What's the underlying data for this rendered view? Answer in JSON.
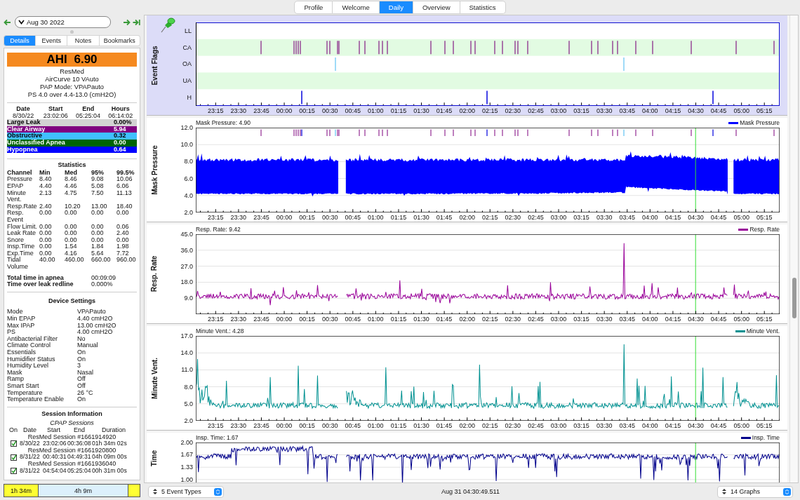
{
  "top_tabs": [
    {
      "label": "Profile",
      "selected": false
    },
    {
      "label": "Welcome",
      "selected": false
    },
    {
      "label": "Daily",
      "selected": true
    },
    {
      "label": "Overview",
      "selected": false
    },
    {
      "label": "Statistics",
      "selected": false
    }
  ],
  "nav": {
    "date": "Aug 30 2022"
  },
  "left_tabs": [
    {
      "label": "Details",
      "selected": true
    },
    {
      "label": "Events",
      "selected": false
    },
    {
      "label": "Notes",
      "selected": false
    },
    {
      "label": "Bookmarks",
      "selected": false
    }
  ],
  "ahi": "AHI 6.90",
  "machine": [
    "ResMed",
    "AirCurve 10 VAuto",
    "PAP Mode: VPAPauto",
    "PS 4.0 over 4.4-13.0 (cmH2O)"
  ],
  "summary": {
    "columns": [
      "Date",
      "Start",
      "End",
      "Hours"
    ],
    "values": [
      "8/30/22",
      "23:02:06",
      "05:25:04",
      "06:14:02"
    ]
  },
  "indices": [
    {
      "name": "Large Leak",
      "value": "0.00%",
      "color": "#d3d3d3"
    },
    {
      "name": "Clear Airway",
      "value": "5.94",
      "color": "#800080"
    },
    {
      "name": "Obstructive",
      "value": "0.32",
      "color": "#40c0ff"
    },
    {
      "name": "Unclassified Apnea",
      "value": "0.00",
      "color": "#006400"
    },
    {
      "name": "Hypopnea",
      "value": "0.64",
      "color": "#0000ff"
    }
  ],
  "statistics": {
    "title": "Statistics",
    "columns": [
      "Channel",
      "Min",
      "Med",
      "95%",
      "99.5%"
    ],
    "rows": [
      [
        "Pressure",
        "8.40",
        "8.46",
        "9.08",
        "10.06"
      ],
      [
        "EPAP",
        "4.40",
        "4.46",
        "5.08",
        "6.06"
      ],
      [
        "Minute Vent.",
        "2.13",
        "4.75",
        "7.50",
        "11.13"
      ],
      [
        "Resp.Rate",
        "2.40",
        "10.20",
        "13.00",
        "18.40"
      ],
      [
        "Resp. Event",
        "0.00",
        "0.00",
        "0.00",
        "0.00"
      ],
      [
        "Flow Limit.",
        "0.00",
        "0.00",
        "0.00",
        "0.06"
      ],
      [
        "Leak Rate",
        "0.00",
        "0.00",
        "0.00",
        "2.40"
      ],
      [
        "Snore",
        "0.00",
        "0.00",
        "0.00",
        "0.00"
      ],
      [
        "Insp.Time",
        "0.00",
        "1.54",
        "1.84",
        "1.98"
      ],
      [
        "Exp.Time",
        "0.00",
        "4.16",
        "5.64",
        "7.72"
      ],
      [
        "Tidal Volume",
        "40.00",
        "460.00",
        "660.00",
        "960.00"
      ]
    ]
  },
  "totals": [
    {
      "label": "Total time in apnea",
      "value": "00:09:09"
    },
    {
      "label": "Time over leak redline",
      "value": "0.000%"
    }
  ],
  "device_settings": {
    "title": "Device Settings",
    "rows": [
      [
        "Mode",
        "VPAPauto"
      ],
      [
        "Min EPAP",
        "4.40 cmH2O"
      ],
      [
        "Max IPAP",
        "13.00 cmH2O"
      ],
      [
        "PS",
        "4.00 cmH2O"
      ],
      [
        "Antibacterial Filter",
        "No"
      ],
      [
        "Climate Control",
        "Manual"
      ],
      [
        "Essentials",
        "On"
      ],
      [
        "Humidifier Status",
        "On"
      ],
      [
        "Humidity Level",
        "3"
      ],
      [
        "Mask",
        "Nasal"
      ],
      [
        "Ramp",
        "Off"
      ],
      [
        "Smart Start",
        "Off"
      ],
      [
        "Temperature",
        "26 °C"
      ],
      [
        "Temperature Enable",
        "On"
      ]
    ]
  },
  "sessions": {
    "title": "Session Information",
    "subtitle": "CPAP Sessions",
    "columns": [
      "On",
      "Date",
      "Start",
      "End",
      "Duration"
    ],
    "items": [
      {
        "name": "ResMed Session #1661914920",
        "checked": true,
        "date": "8/30/22",
        "start": "23:02:06",
        "end": "00:36:08",
        "duration": "01h 34m 02s"
      },
      {
        "name": "ResMed Session #1661920800",
        "checked": true,
        "date": "8/31/22",
        "start": "00:40:31",
        "end": "04:49:31",
        "duration": "04h 09m 00s"
      },
      {
        "name": "ResMed Session #1661936040",
        "checked": true,
        "date": "8/31/22",
        "start": "04:54:04",
        "end": "05:25:04",
        "duration": "00h 31m 00s"
      }
    ]
  },
  "timeline": [
    {
      "label": "1h 34m",
      "color": "#ffff33"
    },
    {
      "label": "4h 9m",
      "color": "#dcf0fc"
    },
    {
      "color": "#ffff33"
    }
  ],
  "graphs": [
    {
      "kind": "flags",
      "label": "Event Flags",
      "rows": [
        "LL",
        "CA",
        "OA",
        "UA",
        "H"
      ],
      "xticks": [
        "23:15",
        "23:30",
        "23:45",
        "00:00",
        "00:15",
        "00:30",
        "00:45",
        "01:00",
        "01:15",
        "01:30",
        "01:45",
        "02:00",
        "02:15",
        "02:30",
        "02:45",
        "03:00",
        "03:15",
        "03:30",
        "03:45",
        "04:00",
        "04:15",
        "04:30",
        "04:45",
        "05:00",
        "05:15"
      ]
    },
    {
      "kind": "pressure",
      "label": "Mask Pressure",
      "title": "Mask Pressure: 4.90",
      "legend": "Mask Pressure",
      "color": "#0000ff",
      "yticks": [
        "12.0",
        "10.0",
        "8.0",
        "6.0",
        "4.0",
        "2.0"
      ],
      "xticks": [
        "23:15",
        "23:30",
        "23:45",
        "00:00",
        "00:15",
        "00:30",
        "00:45",
        "01:00",
        "01:15",
        "01:30",
        "01:45",
        "02:00",
        "02:15",
        "02:30",
        "02:45",
        "03:00",
        "03:15",
        "03:30",
        "03:45",
        "04:00",
        "04:15",
        "04:30",
        "04:45",
        "05:00",
        "05:15"
      ]
    },
    {
      "kind": "resp",
      "label": "Resp. Rate",
      "title": "Resp. Rate: 9.42",
      "legend": "Resp. Rate",
      "color": "#990099",
      "yticks": [
        "45.0",
        "36.0",
        "27.0",
        "18.0",
        "9.0"
      ],
      "xticks": [
        "23:15",
        "23:30",
        "23:45",
        "00:00",
        "00:15",
        "00:30",
        "00:45",
        "01:00",
        "01:15",
        "01:30",
        "01:45",
        "02:00",
        "02:15",
        "02:30",
        "02:45",
        "03:00",
        "03:15",
        "03:30",
        "03:45",
        "04:00",
        "04:15",
        "04:30",
        "04:45",
        "05:00",
        "05:15"
      ]
    },
    {
      "kind": "vent",
      "label": "Minute Vent.",
      "title": "Minute Vent.: 4.28",
      "legend": "Minute Vent.",
      "color": "#009191",
      "yticks": [
        "17.0",
        "14.0",
        "11.0",
        "8.0",
        "5.0",
        "2.0"
      ],
      "xticks": [
        "23:15",
        "23:30",
        "23:45",
        "00:00",
        "00:15",
        "00:30",
        "00:45",
        "01:00",
        "01:15",
        "01:30",
        "01:45",
        "02:00",
        "02:15",
        "02:30",
        "02:45",
        "03:00",
        "03:15",
        "03:30",
        "03:45",
        "04:00",
        "04:15",
        "04:30",
        "04:45",
        "05:00",
        "05:15"
      ]
    },
    {
      "kind": "insp",
      "label": "Time",
      "title": "Insp. Time: 1.67",
      "legend": "Insp. Time",
      "color": "#00008b",
      "yticks": [
        "2.00",
        "1.67",
        "1.33",
        "1.00"
      ]
    }
  ],
  "bottom_bar": {
    "event_types": "5 Event Types",
    "time": "Aug 31 04:30:49.511",
    "graphs": "14 Graphs"
  }
}
